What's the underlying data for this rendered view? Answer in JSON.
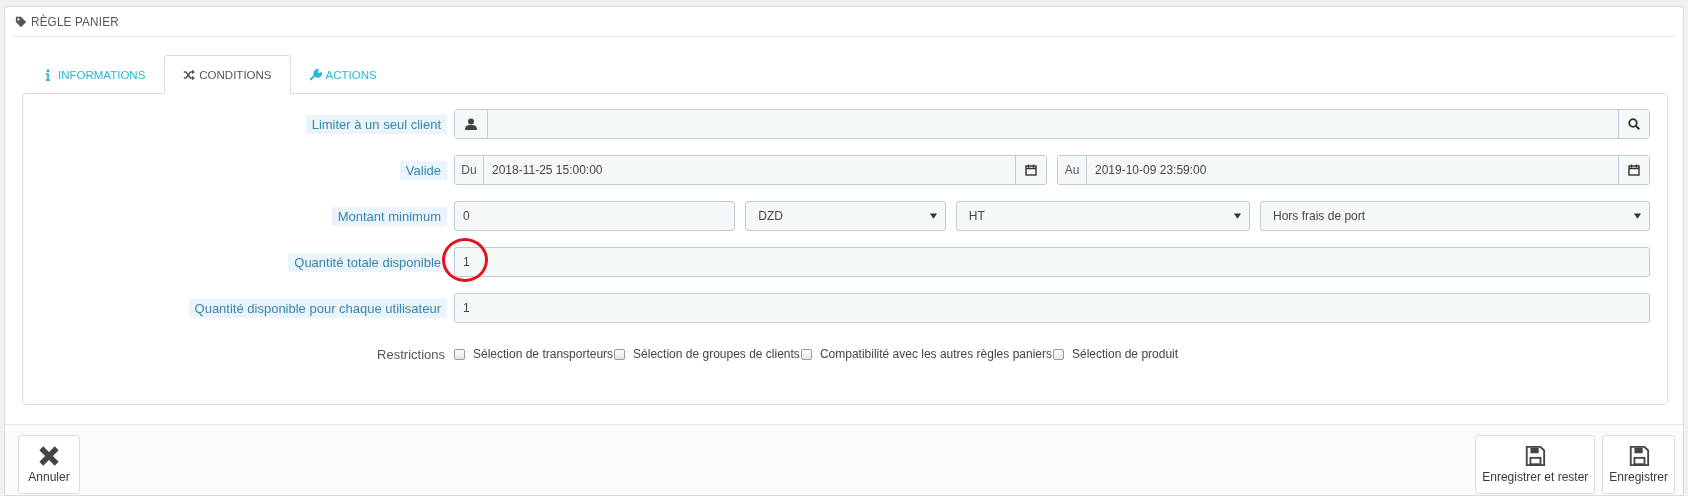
{
  "panel": {
    "title": "RÈGLE PANIER"
  },
  "tabs": [
    {
      "label": "INFORMATIONS",
      "kind": "info",
      "selected": false
    },
    {
      "label": "CONDITIONS",
      "kind": "conditions",
      "selected": true
    },
    {
      "label": "ACTIONS",
      "kind": "actions",
      "selected": false
    }
  ],
  "rows": [
    {
      "kind": "client",
      "label": "Limiter à un seul client"
    },
    {
      "kind": "dates",
      "label": "Valide",
      "from_prefix": "Du",
      "from_value": "2018-11-25 15:00:00",
      "to_prefix": "Au",
      "to_value": "2019-10-09 23:59:00"
    },
    {
      "kind": "amount",
      "label": "Montant minimum",
      "value": "0",
      "selects": [
        "DZD",
        "HT",
        "Hors frais de port"
      ]
    },
    {
      "kind": "text",
      "label": "Quantité totale disponible",
      "value": "1",
      "circled": true
    },
    {
      "kind": "text",
      "label": "Quantité disponible pour chaque utilisateur",
      "value": "1",
      "circled": false
    },
    {
      "kind": "checks",
      "label": "Restrictions",
      "options": [
        {
          "label": "Sélection de transporteurs",
          "checked": false
        },
        {
          "label": "Sélection de groupes de clients",
          "checked": false
        },
        {
          "label": "Compatibilité avec les autres règles paniers",
          "checked": false
        },
        {
          "label": "Sélection de produit",
          "checked": false
        }
      ]
    }
  ],
  "footer": {
    "left": [
      {
        "label": "Annuler",
        "kind": "cancel"
      }
    ],
    "right": [
      {
        "label": "Enregistrer et rester",
        "kind": "save"
      },
      {
        "label": "Enregistrer",
        "kind": "save"
      }
    ]
  }
}
